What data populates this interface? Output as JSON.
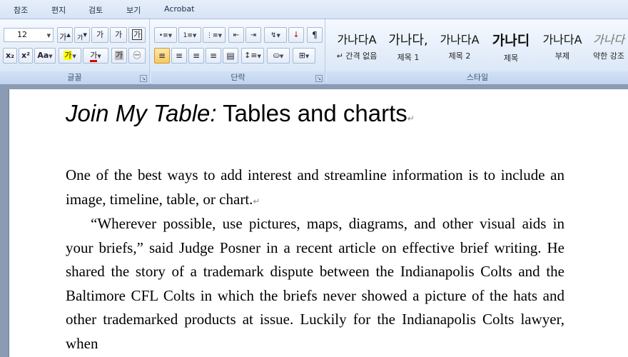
{
  "menu": {
    "tabs": [
      "참조",
      "편지",
      "검토",
      "보기",
      "Acrobat"
    ]
  },
  "ribbon": {
    "font_size": "12",
    "groups": {
      "font": "글꼴",
      "paragraph": "단락",
      "styles": "스타일"
    },
    "font_buttons": {
      "grow": "가",
      "shrink": "가",
      "phonetic": "가",
      "enclosed": "가",
      "border": "가",
      "subscript": "x₂",
      "superscript": "x²",
      "change_case": "Aa",
      "highlight": "가",
      "font_color": "가",
      "char_shading": "가",
      "enclose": "㊀"
    },
    "style_gallery": [
      {
        "sample": "가나다A",
        "name": "↵ 간격 없음"
      },
      {
        "sample": "가나다,",
        "name": "제목 1"
      },
      {
        "sample": "가나다A",
        "name": "제목 2"
      },
      {
        "sample": "가나디",
        "name": "제목"
      },
      {
        "sample": "가나다A",
        "name": "부제"
      },
      {
        "sample": "가나다",
        "name": "약한 강조"
      }
    ]
  },
  "document": {
    "title_italic": "Join My Table:",
    "title_rest": " Tables and charts",
    "para1": "One of the best ways to add interest and streamline information is to include an image, timeline, table, or chart.",
    "para2": "“Wherever possible, use pictures, maps, diagrams, and other visual aids in your briefs,” said Judge Posner in a recent article on effective brief writing. He shared the story of a trademark dispute between the Indianapolis Colts and the Baltimore CFL Colts in which the briefs never showed a picture of the hats and other trademarked products at issue. Luckily for the Indianapolis Colts lawyer, when",
    "mark": "↵"
  },
  "colors": {
    "ribbon_bg": "#dfe9f7",
    "highlight": "#ffff00",
    "font_color": "#e00000",
    "accent_selected": "#f8c85c"
  }
}
